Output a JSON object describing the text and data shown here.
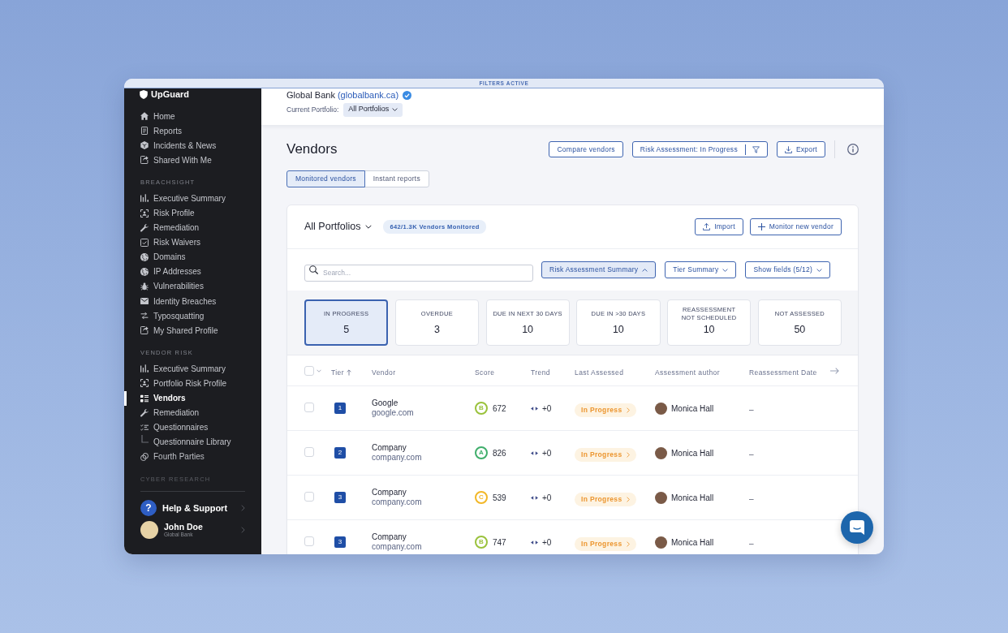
{
  "banner": {
    "text": "FILTERS ACTIVE"
  },
  "sidebar": {
    "logo": "UpGuard",
    "sections": [
      {
        "items": [
          {
            "label": "Home",
            "selected": false
          },
          {
            "label": "Reports",
            "selected": false
          },
          {
            "label": "Incidents & News",
            "selected": false
          },
          {
            "label": "Shared With Me",
            "selected": false
          }
        ]
      },
      {
        "heading": "BREACHSIGHT",
        "items": [
          {
            "label": "Executive Summary",
            "selected": false
          },
          {
            "label": "Risk Profile",
            "selected": false
          },
          {
            "label": "Remediation",
            "selected": false
          },
          {
            "label": "Risk Waivers",
            "selected": false
          },
          {
            "label": "Domains",
            "selected": false
          },
          {
            "label": "IP Addresses",
            "selected": false
          },
          {
            "label": "Vulnerabilities",
            "selected": false
          },
          {
            "label": "Identity Breaches",
            "selected": false
          },
          {
            "label": "Typosquatting",
            "selected": false
          },
          {
            "label": "My Shared Profile",
            "selected": false
          }
        ]
      },
      {
        "heading": "VENDOR RISK",
        "items": [
          {
            "label": "Executive Summary",
            "selected": false
          },
          {
            "label": "Portfolio Risk Profile",
            "selected": false
          },
          {
            "label": "Vendors",
            "selected": true
          },
          {
            "label": "Remediation",
            "selected": false
          },
          {
            "label": "Questionnaires",
            "selected": false,
            "children": [
              {
                "label": "Questionnaire Library",
                "selected": false
              }
            ]
          },
          {
            "label": "Fourth Parties",
            "selected": false
          }
        ]
      },
      {
        "heading": "CYBER RESEARCH"
      }
    ],
    "help": {
      "badge": "?",
      "label": "Help & Support"
    },
    "user": {
      "name": "John Doe",
      "org": "Global Bank"
    }
  },
  "header": {
    "company": "Global Bank",
    "domain": "(globalbank.ca)",
    "verified": true,
    "portfolio_label": "Current Portfolio:",
    "portfolio": "All Portfolios"
  },
  "page": {
    "title": "Vendors",
    "actions": [
      {
        "kind": "compare",
        "label": "Compare vendors"
      },
      {
        "kind": "filter",
        "label": "Risk Assessment: In Progress"
      },
      {
        "kind": "export",
        "label": "Export"
      }
    ],
    "tabs": [
      {
        "label": "Monitored vendors",
        "selected": true
      },
      {
        "label": "Instant reports",
        "selected": false
      }
    ]
  },
  "card": {
    "portfolio": "All Portfolios",
    "count_badge": "642/1.3K Vendors Monitored",
    "actions": [
      {
        "kind": "import",
        "label": "Import"
      },
      {
        "kind": "add",
        "label": "Monitor new vendor"
      }
    ],
    "search": {
      "placeholder": "Search..."
    },
    "toggles": [
      {
        "label": "Risk Assessment Summary",
        "expanded": true
      },
      {
        "label": "Tier Summary",
        "expanded": false
      },
      {
        "label": "Show fields (5/12)",
        "expanded": false
      }
    ],
    "summary": [
      {
        "label": "IN PROGRESS",
        "count": "5",
        "selected": true
      },
      {
        "label": "OVERDUE",
        "count": "3",
        "selected": false
      },
      {
        "label": "DUE IN NEXT 30 DAYS",
        "count": "10",
        "selected": false
      },
      {
        "label": "DUE IN >30 DAYS",
        "count": "10",
        "selected": false
      },
      {
        "label": "REASSESSMENT NOT SCHEDULED",
        "count": "10",
        "selected": false
      },
      {
        "label": "NOT ASSESSED",
        "count": "50",
        "selected": false
      }
    ],
    "table": {
      "select_all": false,
      "columns": [
        {
          "label": "Tier",
          "sorted": true
        },
        {
          "label": "Vendor",
          "sorted": false
        },
        {
          "label": "Score",
          "sorted": false
        },
        {
          "label": "Trend",
          "sorted": false
        },
        {
          "label": "Last Assessed",
          "sorted": false
        },
        {
          "label": "Assessment author",
          "sorted": false
        },
        {
          "label": "Reassessment Date",
          "sorted": false
        }
      ],
      "rows": [
        {
          "selected": false,
          "tier": "1",
          "name": "Google",
          "domain": "google.com",
          "grade": {
            "letter": "B",
            "color": "#9ac23c"
          },
          "score": "672",
          "trend": "+0",
          "status": "In Progress",
          "author": "Monica Hall",
          "reassessment": "–"
        },
        {
          "selected": false,
          "tier": "2",
          "name": "Company",
          "domain": "company.com",
          "grade": {
            "letter": "A",
            "color": "#3fae6b"
          },
          "score": "826",
          "trend": "+0",
          "status": "In Progress",
          "author": "Monica Hall",
          "reassessment": "–"
        },
        {
          "selected": false,
          "tier": "3",
          "name": "Company",
          "domain": "company.com",
          "grade": {
            "letter": "C",
            "color": "#f2b727"
          },
          "score": "539",
          "trend": "+0",
          "status": "In Progress",
          "author": "Monica Hall",
          "reassessment": "–"
        },
        {
          "selected": false,
          "tier": "3",
          "name": "Company",
          "domain": "company.com",
          "grade": {
            "letter": "B",
            "color": "#9ac23c"
          },
          "score": "747",
          "trend": "+0",
          "status": "In Progress",
          "author": "Monica Hall",
          "reassessment": "–"
        }
      ]
    }
  }
}
